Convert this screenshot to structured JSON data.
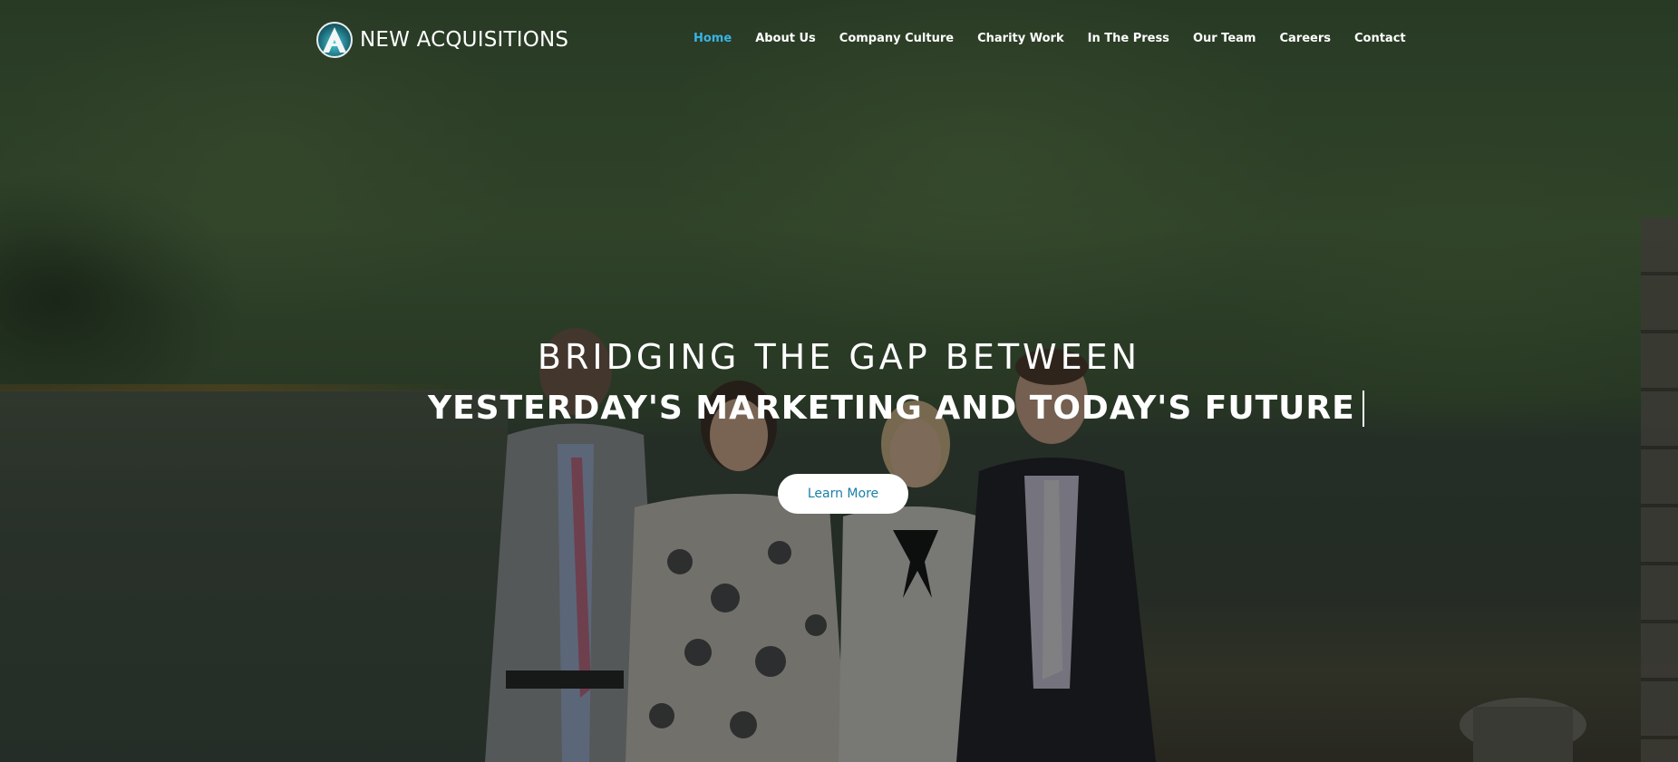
{
  "brand": {
    "name": "NEW ACQUISITIONS",
    "logo_icon": "mountain-a-logo-icon",
    "accent_color": "#39b3e6"
  },
  "nav": {
    "items": [
      {
        "label": "Home",
        "active": true
      },
      {
        "label": "About Us",
        "active": false
      },
      {
        "label": "Company Culture",
        "active": false
      },
      {
        "label": "Charity Work",
        "active": false
      },
      {
        "label": "In The Press",
        "active": false
      },
      {
        "label": "Our Team",
        "active": false
      },
      {
        "label": "Careers",
        "active": false
      },
      {
        "label": "Contact",
        "active": false
      }
    ]
  },
  "hero": {
    "headline": "BRIDGING THE GAP BETWEEN",
    "subheadline": "YESTERDAY'S MARKETING AND TODAY'S FUTURE",
    "cta_label": "Learn More",
    "cta_text_color": "#1a7fa8"
  }
}
